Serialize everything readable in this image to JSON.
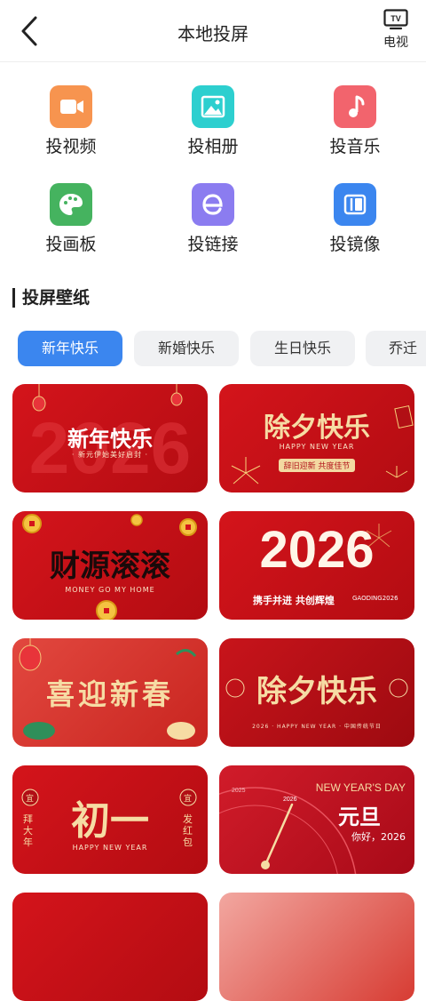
{
  "header": {
    "title": "本地投屏",
    "tv_icon_text": "TV",
    "tv_label": "电视"
  },
  "grid": [
    {
      "label": "投视频",
      "icon": "video-icon",
      "color": "#f7944f"
    },
    {
      "label": "投相册",
      "icon": "image-icon",
      "color": "#2dcfcf"
    },
    {
      "label": "投音乐",
      "icon": "music-icon",
      "color": "#f2646d"
    },
    {
      "label": "投画板",
      "icon": "palette-icon",
      "color": "#45b35f"
    },
    {
      "label": "投链接",
      "icon": "link-e-icon",
      "color": "#8b7cf0"
    },
    {
      "label": "投镜像",
      "icon": "mirror-icon",
      "color": "#3b86ef"
    }
  ],
  "section_title": "投屏壁纸",
  "chips": [
    {
      "label": "新年快乐",
      "active": true
    },
    {
      "label": "新婚快乐",
      "active": false
    },
    {
      "label": "生日快乐",
      "active": false
    },
    {
      "label": "乔迁",
      "active": false
    }
  ],
  "cards": [
    {
      "main": "新年快乐",
      "sub": "· 新元伊始美好启封 ·",
      "extra": "2026"
    },
    {
      "main": "除夕快乐",
      "sub": "HAPPY NEW YEAR",
      "extra": "辞旧迎新 共度佳节"
    },
    {
      "main": "财源滚滚",
      "sub": "MONEY  GO  MY  HOME",
      "extra": ""
    },
    {
      "main": "2026",
      "sub": "携手并进 共创辉煌",
      "extra": "GAODING2026"
    },
    {
      "main": "喜迎新春",
      "sub": "",
      "extra": ""
    },
    {
      "main": "除夕快乐",
      "sub": "2026 · HAPPY NEW YEAR · 中国传统节日",
      "extra": ""
    },
    {
      "main": "初一",
      "sub": "HAPPY NEW YEAR",
      "extra_left": "拜大年",
      "extra_right": "发红包",
      "tag": "宜"
    },
    {
      "main": "元旦",
      "sub": "你好，2026",
      "extra": "NEW YEAR'S DAY",
      "year_a": "2025",
      "year_b": "2026"
    }
  ],
  "colors": {
    "accent": "#3b86ef",
    "card_red": "#d4141b",
    "gold": "#f6dca4"
  }
}
